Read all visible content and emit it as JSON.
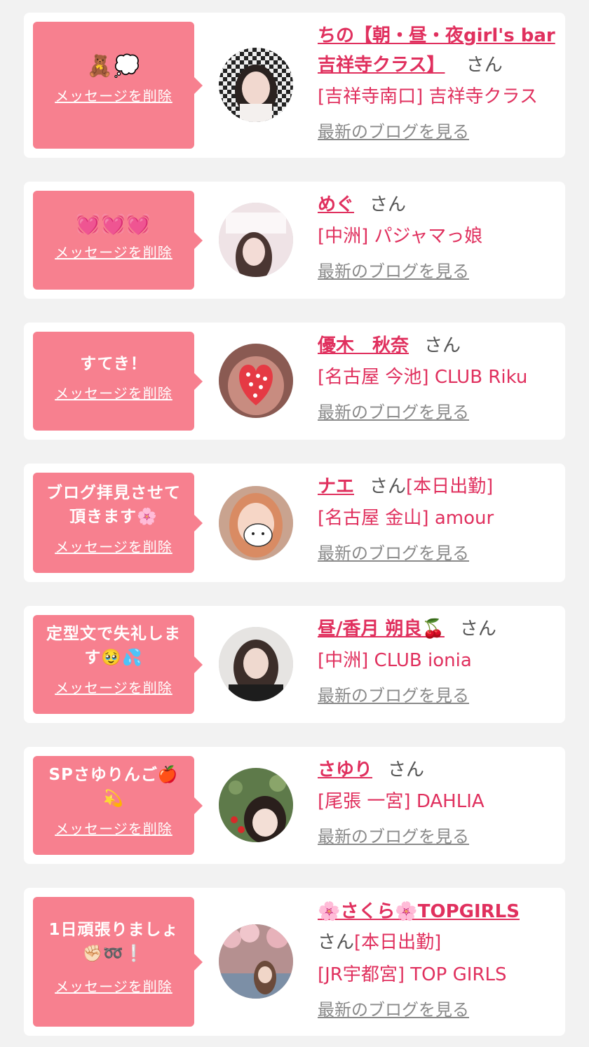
{
  "entries": [
    {
      "message": "🧸💭",
      "delete_label": "メッセージを削除",
      "name": "ちの【朝・昼・夜girl's bar 吉祥寺クラス】",
      "name_line1": "ちの【朝・昼・夜girl's bar",
      "name_line2": "吉祥寺クラス】",
      "suffix": "さん",
      "status": "",
      "shop": "[吉祥寺南口] 吉祥寺クラス",
      "blog_label": "最新のブログを見る"
    },
    {
      "message": "💓💓💓",
      "delete_label": "メッセージを削除",
      "name": "めぐ",
      "suffix": "さん",
      "status": "",
      "shop": "[中洲] パジャマっ娘",
      "blog_label": "最新のブログを見る"
    },
    {
      "message": "すてき！",
      "delete_label": "メッセージを削除",
      "name": "優木　秋奈",
      "suffix": "さん",
      "status": "",
      "shop": "[名古屋 今池] CLUB Riku",
      "blog_label": "最新のブログを見る"
    },
    {
      "message_line1": "ブログ拝見させて",
      "message_line2": "頂きます🌸",
      "delete_label": "メッセージを削除",
      "name": "ナエ",
      "suffix": "さん",
      "status": "[本日出勤]",
      "shop": "[名古屋 金山] amour",
      "blog_label": "最新のブログを見る"
    },
    {
      "message_line1": "定型文で失礼しま",
      "message_line2": "す🥹💦",
      "delete_label": "メッセージを削除",
      "name": "昼/香月 朔良🍒",
      "suffix": "さん",
      "status": "",
      "shop": "[中洲] CLUB ionia",
      "blog_label": "最新のブログを見る"
    },
    {
      "message_line1": "SPさゆりんご🍎",
      "message_line2": "💫",
      "delete_label": "メッセージを削除",
      "name": "さゆり",
      "suffix": "さん",
      "status": "",
      "shop": "[尾張 一宮] DAHLIA",
      "blog_label": "最新のブログを見る"
    },
    {
      "message_line1": "1日頑張りましょ",
      "message_line2": "✊🏻➿❕",
      "delete_label": "メッセージを削除",
      "name": "🌸さくら🌸TOPGIRLS",
      "suffix": "さん",
      "status": "[本日出勤]",
      "shop": "[JR宇都宮] TOP GIRLS",
      "blog_label": "最新のブログを見る"
    }
  ]
}
